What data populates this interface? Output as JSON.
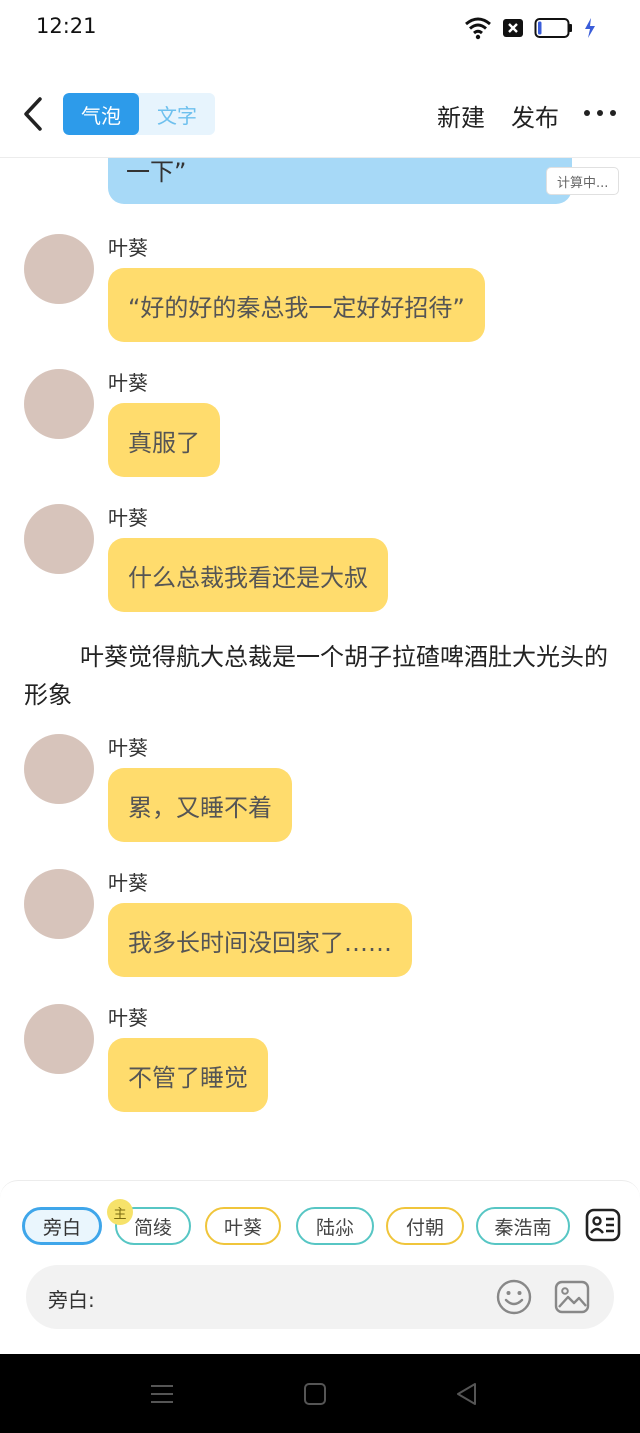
{
  "status_bar": {
    "time": "12:21",
    "icons": [
      "wifi-icon",
      "sim-blocked-icon",
      "battery-icon",
      "charging-icon"
    ],
    "battery_level": 0.12
  },
  "header": {
    "back_icon": "chevron-left-icon",
    "mode_bubble": "气泡",
    "mode_text": "文字",
    "active_mode": "气泡",
    "new_label": "新建",
    "publish_label": "发布",
    "more_icon": "more-horizontal-icon"
  },
  "chat": {
    "partial_bubble_text": "一下”",
    "calc_badge": "计算中...",
    "messages": [
      {
        "speaker": "叶葵",
        "text": "“好的好的秦总我一定好好招待”"
      },
      {
        "speaker": "叶葵",
        "text": "真服了"
      },
      {
        "speaker": "叶葵",
        "text": "什么总裁我看还是大叔"
      },
      {
        "speaker": "叶葵",
        "text": "累，又睡不着"
      },
      {
        "speaker": "叶葵",
        "text": "我多长时间没回家了……"
      },
      {
        "speaker": "叶葵",
        "text": "不管了睡觉"
      }
    ],
    "narration": "叶葵觉得航大总裁是一个胡子拉碴啤酒肚大光头的形象"
  },
  "role_bar": {
    "roles": [
      "旁白",
      "简绫",
      "叶葵",
      "陆尛",
      "付朝",
      "秦浩南"
    ],
    "selected": "旁白",
    "host_badge": "主",
    "role_card_icon": "role-card-icon"
  },
  "input": {
    "label": "旁白:",
    "emoji_icon": "smiley-icon",
    "image_icon": "image-icon"
  },
  "nav_bar": {
    "icons": [
      "menu-icon",
      "home-icon",
      "back-triangle-icon"
    ]
  },
  "colors": {
    "accent_blue": "#2d9bea",
    "bubble_blue": "#a7d9f7",
    "bubble_yellow": "#ffdc6d",
    "chip_teal": "#57c6c4",
    "chip_yellow": "#f0c53b"
  }
}
